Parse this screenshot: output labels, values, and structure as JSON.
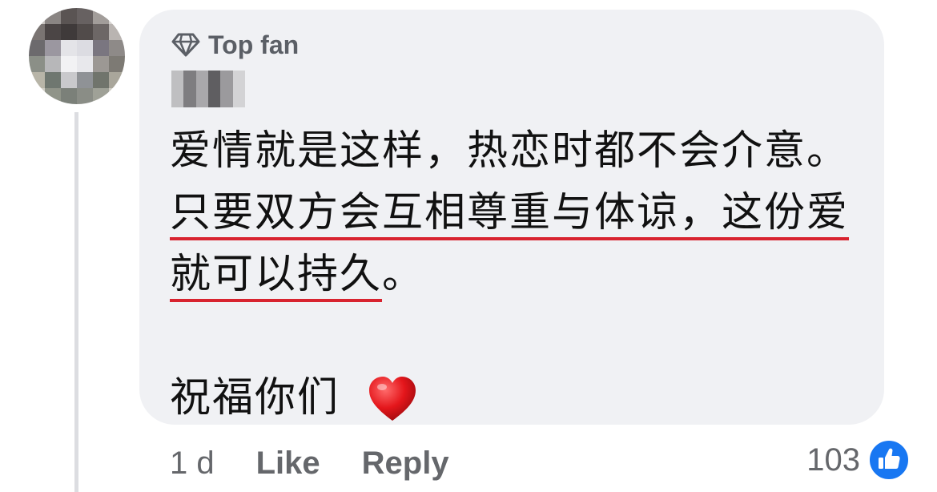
{
  "comment": {
    "badge_label": "Top fan",
    "text_line1": "爱情就是这样，热恋时都不会介意。",
    "text_underlined": "只要双方会互相尊重与体谅，这份爱就可以持久",
    "text_end": "。",
    "blessing": "祝福你们",
    "emoji": "heart-emoji",
    "underline_color": "#d8232f"
  },
  "meta": {
    "time": "1 d",
    "like_label": "Like",
    "reply_label": "Reply",
    "reaction_count": "103",
    "reaction_icon": "thumbs-up-icon",
    "reaction_color": "#1877f2"
  }
}
